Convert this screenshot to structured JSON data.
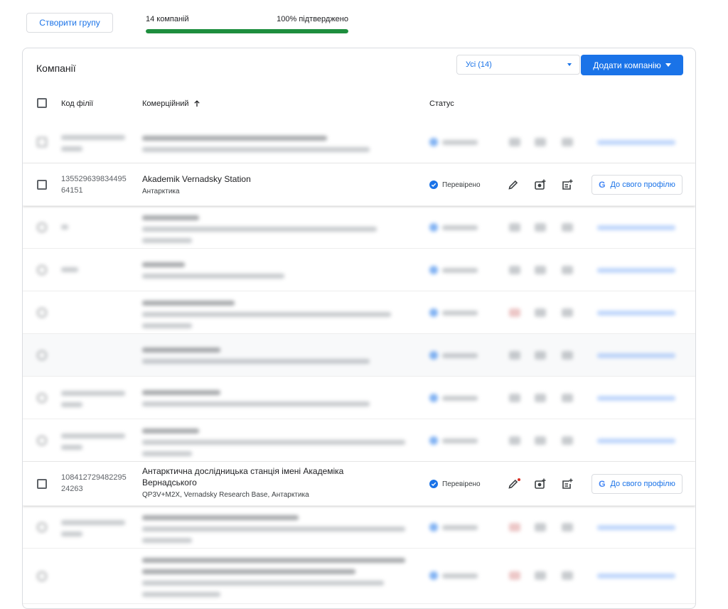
{
  "toolbar": {
    "create_group_label": "Створити групу"
  },
  "progress": {
    "companies_label": "14 компаній",
    "verified_label": "100% підтверджено",
    "value_fraction": 1.0
  },
  "card": {
    "title": "Компанії",
    "filter_value": "Усі (14)",
    "add_company_label": "Додати компанію"
  },
  "table": {
    "headers": {
      "code": "Код філії",
      "name": "Комерційний",
      "status": "Статус"
    },
    "rows": [
      {
        "code_line1": "135529639834495",
        "code_line2": "64151",
        "name": "Akademik Vernadsky Station",
        "address": "Антарктика",
        "status": "Перевірено",
        "profile_label": "До свого профілю"
      },
      {
        "code_line1": "108412729482295",
        "code_line2": "24263",
        "name_line1": "Антарктична дослідницька станція імені Академіка",
        "name_line2": "Вернадського",
        "address": "QP3V+M2X, Vernadsky Research Base, Антарктика",
        "status": "Перевірено",
        "profile_label": "До свого профілю"
      }
    ]
  },
  "colors": {
    "accent": "#1a73e8",
    "progress": "#1e8e3e",
    "notification": "#d93025"
  },
  "icons": [
    "pencil-icon",
    "add-photo-icon",
    "add-post-icon",
    "google-g-icon",
    "verified-check-icon",
    "sort-arrow-up-icon"
  ]
}
